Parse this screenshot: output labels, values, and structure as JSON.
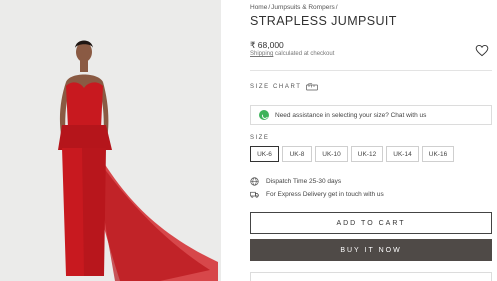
{
  "breadcrumb": {
    "home": "Home",
    "separator": "/",
    "category": "Jumpsuits & Rompers"
  },
  "product": {
    "title": "STRAPLESS JUMPSUIT",
    "price": "₹ 68,000",
    "shipping_prefix": "Shipping",
    "shipping_suffix": " calculated at checkout"
  },
  "size_chart": {
    "label": "SIZE CHART",
    "icon": "ruler-icon"
  },
  "assistance": {
    "text": "Need assistance in selecting your size? Chat with us",
    "icon": "whatsapp-icon"
  },
  "size_selector": {
    "label": "SIZE",
    "options": [
      "UK-6",
      "UK-8",
      "UK-10",
      "UK-12",
      "UK-14",
      "UK-16"
    ],
    "selected": "UK-6"
  },
  "delivery": {
    "dispatch_text": "Dispatch Time 25-30 days",
    "dispatch_icon": "globe-icon",
    "express_text": "For Express Delivery get in touch with us",
    "express_icon": "truck-icon"
  },
  "actions": {
    "add_to_cart": "ADD TO CART",
    "buy_now": "BUY IT NOW",
    "wishlist_icon": "heart-icon"
  },
  "colors": {
    "dress_red": "#c8191f",
    "buy_button": "#4f4a47",
    "whatsapp_green": "#3db35a",
    "photo_bg": "#ebebea"
  }
}
